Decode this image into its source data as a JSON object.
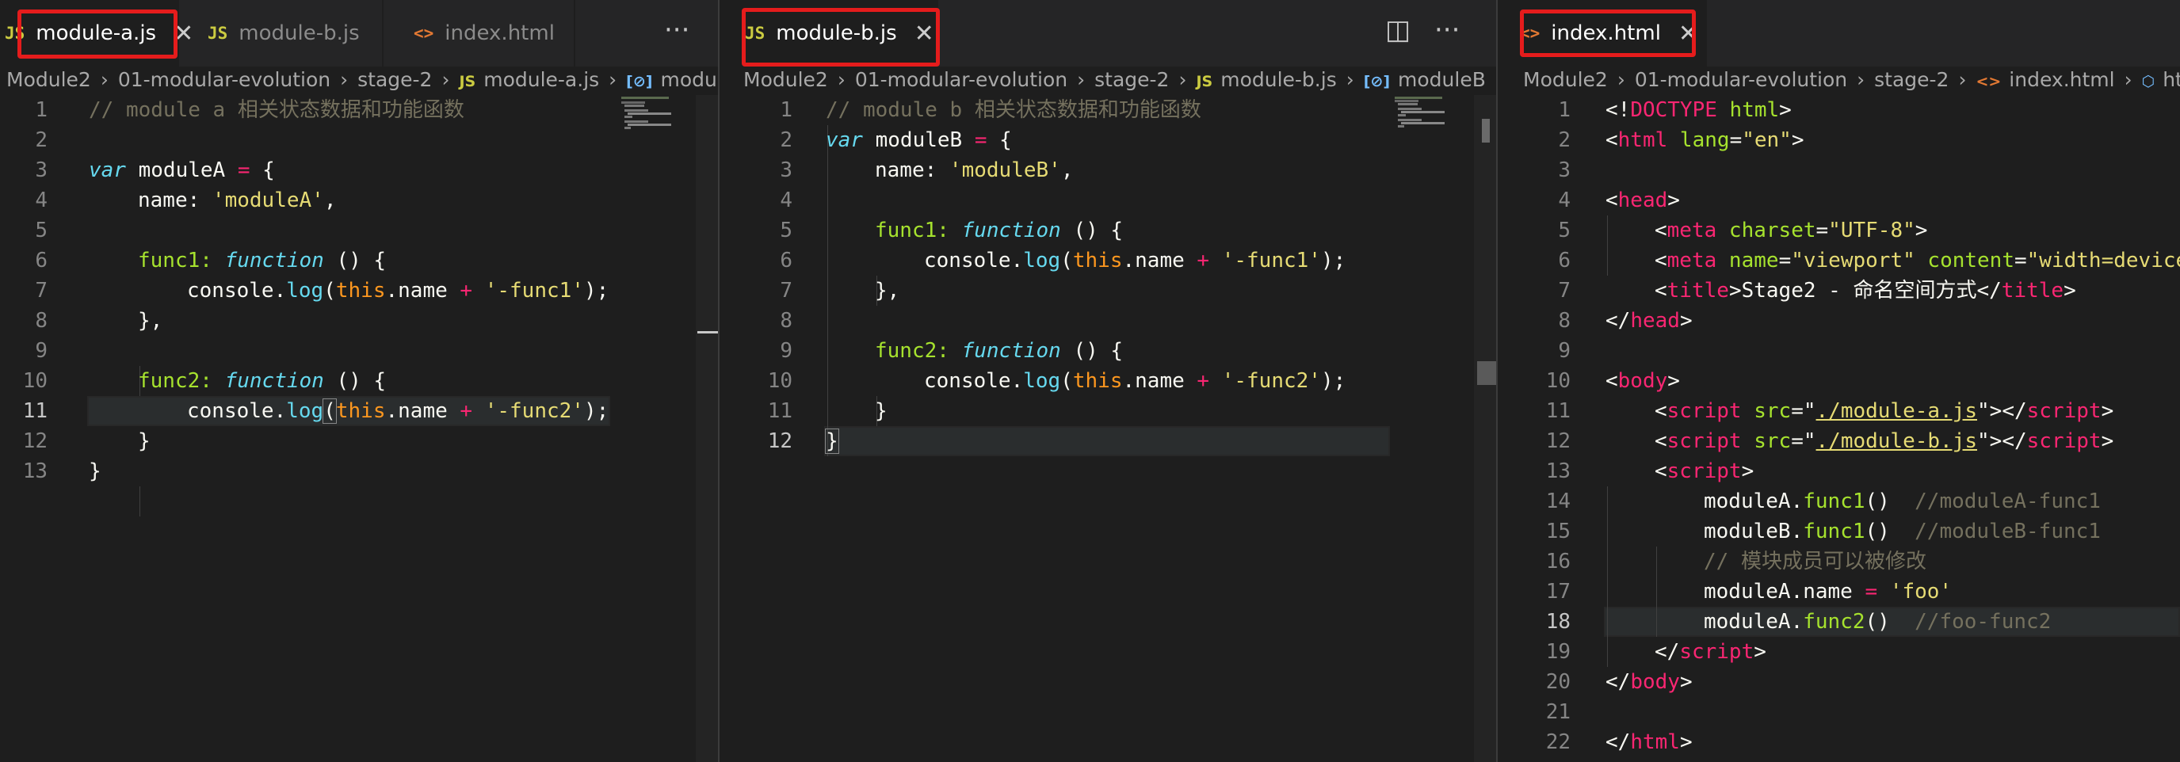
{
  "groups": [
    {
      "tabs": [
        {
          "icon": "JS",
          "label": "module-a.js",
          "active": true,
          "close": "✕"
        },
        {
          "icon": "JS",
          "label": "module-b.js",
          "active": false
        },
        {
          "icon": "<>",
          "label": "index.html",
          "active": false
        }
      ],
      "more": "···",
      "breadcrumb": [
        "Module2",
        "01-modular-evolution",
        "stage-2",
        "module-a.js",
        "moduleA"
      ],
      "line_numbers": [
        "1",
        "2",
        "3",
        "4",
        "5",
        "6",
        "7",
        "8",
        "9",
        "10",
        "11",
        "12",
        "13"
      ]
    },
    {
      "tabs": [
        {
          "icon": "JS",
          "label": "module-b.js",
          "active": true,
          "close": "✕"
        }
      ],
      "split": "◫",
      "more": "···",
      "breadcrumb": [
        "Module2",
        "01-modular-evolution",
        "stage-2",
        "module-b.js",
        "moduleB"
      ],
      "line_numbers": [
        "1",
        "2",
        "3",
        "4",
        "5",
        "6",
        "7",
        "8",
        "9",
        "10",
        "11",
        "12"
      ]
    },
    {
      "tabs": [
        {
          "icon": "<>",
          "label": "index.html",
          "active": true,
          "close": "✕"
        }
      ],
      "breadcrumb": [
        "Module2",
        "01-modular-evolution",
        "stage-2",
        "index.html",
        "html"
      ],
      "line_numbers": [
        "1",
        "2",
        "3",
        "4",
        "5",
        "6",
        "7",
        "8",
        "9",
        "10",
        "11",
        "12",
        "13",
        "14",
        "15",
        "16",
        "17",
        "18",
        "19",
        "20",
        "21",
        "22"
      ]
    }
  ],
  "code_a": {
    "l1": "// module a 相关状态数据和功能函数",
    "l3_kw": "var",
    "l3_name": " moduleA ",
    "l3_op": "=",
    "l3_rest": " {",
    "l4_key": "name: ",
    "l4_str": "'moduleA'",
    "l4_end": ",",
    "l6_key": "func1: ",
    "l6_kw": "function",
    "l6_rest": " () {",
    "l7_a": "console.",
    "l7_fn": "log",
    "l7_b": "(",
    "l7_this": "this",
    "l7_c": ".name ",
    "l7_op": "+",
    "l7_d": " ",
    "l7_str": "'-func1'",
    "l7_e": ");",
    "l8": "},",
    "l10_key": "func2: ",
    "l10_kw": "function",
    "l10_rest": " () {",
    "l11_a": "console.",
    "l11_fn": "log",
    "l11_b": "(",
    "l11_this": "this",
    "l11_c": ".name ",
    "l11_op": "+",
    "l11_d": " ",
    "l11_str": "'-func2'",
    "l11_e": ");",
    "l12": "}",
    "l13": "}"
  },
  "code_b": {
    "l1": "// module b 相关状态数据和功能函数",
    "l2_kw": "var",
    "l2_name": " moduleB ",
    "l2_op": "=",
    "l2_rest": " {",
    "l3_key": "name: ",
    "l3_str": "'moduleB'",
    "l3_end": ",",
    "l5_key": "func1: ",
    "l5_kw": "function",
    "l5_rest": " () {",
    "l6_a": "console.",
    "l6_fn": "log",
    "l6_b": "(",
    "l6_this": "this",
    "l6_c": ".name ",
    "l6_op": "+",
    "l6_d": " ",
    "l6_str": "'-func1'",
    "l6_e": ");",
    "l7": "},",
    "l9_key": "func2: ",
    "l9_kw": "function",
    "l9_rest": " () {",
    "l10_a": "console.",
    "l10_fn": "log",
    "l10_b": "(",
    "l10_this": "this",
    "l10_c": ".name ",
    "l10_op": "+",
    "l10_d": " ",
    "l10_str": "'-func2'",
    "l10_e": ");",
    "l11": "}",
    "l12": "}"
  },
  "code_html": {
    "l1_a": "<!",
    "l1_tag": "DOCTYPE",
    "l1_attr": " html",
    "l1_b": ">",
    "l2_a": "<",
    "l2_tag": "html",
    "l2_attr": " lang",
    "l2_b": "=",
    "l2_str": "\"en\"",
    "l2_c": ">",
    "l4_a": "<",
    "l4_tag": "head",
    "l4_b": ">",
    "l5_a": "<",
    "l5_tag": "meta",
    "l5_attr": " charset",
    "l5_b": "=",
    "l5_str": "\"UTF-8\"",
    "l5_c": ">",
    "l6_a": "<",
    "l6_tag": "meta",
    "l6_attr1": " name",
    "l6_b": "=",
    "l6_str1": "\"viewport\"",
    "l6_attr2": " content",
    "l6_c": "=",
    "l6_str2": "\"width=device",
    "l7_a": "<",
    "l7_tag": "title",
    "l7_b": ">",
    "l7_text": "Stage2 - 命名空间方式",
    "l7_c": "</",
    "l7_tag2": "title",
    "l7_d": ">",
    "l8_a": "</",
    "l8_tag": "head",
    "l8_b": ">",
    "l10_a": "<",
    "l10_tag": "body",
    "l10_b": ">",
    "l11_a": "<",
    "l11_tag": "script",
    "l11_attr": " src",
    "l11_b": "=\"",
    "l11_url": "./module-a.js",
    "l11_c": "\">",
    "l11_d": "</",
    "l11_tag2": "script",
    "l11_e": ">",
    "l12_a": "<",
    "l12_tag": "script",
    "l12_attr": " src",
    "l12_b": "=\"",
    "l12_url": "./module-b.js",
    "l12_c": "\">",
    "l12_d": "</",
    "l12_tag2": "script",
    "l12_e": ">",
    "l13_a": "<",
    "l13_tag": "script",
    "l13_b": ">",
    "l14_a": "moduleA.",
    "l14_fn": "func1",
    "l14_b": "()  ",
    "l14_com": "//moduleA-func1",
    "l15_a": "moduleB.",
    "l15_fn": "func1",
    "l15_b": "()  ",
    "l15_com": "//moduleB-func1",
    "l16_com": "// 模块成员可以被修改",
    "l17_a": "moduleA.name ",
    "l17_op": "=",
    "l17_b": " ",
    "l17_str": "'foo'",
    "l18_a": "moduleA.",
    "l18_fn": "func2",
    "l18_b": "()  ",
    "l18_com": "//foo-func2",
    "l19_a": "</",
    "l19_tag": "script",
    "l19_b": ">",
    "l20_a": "</",
    "l20_tag": "body",
    "l20_b": ">",
    "l22_a": "</",
    "l22_tag": "html",
    "l22_b": ">"
  },
  "colors": {
    "highlight": "#e51c1c",
    "editor_bg": "#1e1e1e",
    "tabbar_bg": "#252526"
  }
}
